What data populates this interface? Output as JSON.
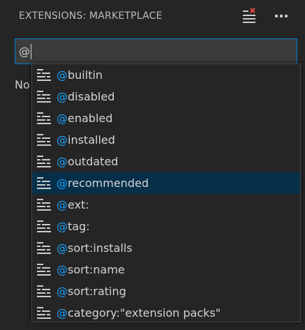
{
  "header": {
    "title": "EXTENSIONS: MARKETPLACE",
    "actions": [
      {
        "name": "clear-list-icon"
      },
      {
        "name": "more-actions-icon"
      }
    ]
  },
  "search": {
    "value": "@"
  },
  "status_text": "No",
  "suggestions": {
    "match_color": "#18a3ff",
    "selected_index": 5,
    "icon": "text-lines-icon",
    "items": [
      {
        "match": "@",
        "rest": "builtin"
      },
      {
        "match": "@",
        "rest": "disabled"
      },
      {
        "match": "@",
        "rest": "enabled"
      },
      {
        "match": "@",
        "rest": "installed"
      },
      {
        "match": "@",
        "rest": "outdated"
      },
      {
        "match": "@",
        "rest": "recommended"
      },
      {
        "match": "@",
        "rest": "ext:"
      },
      {
        "match": "@",
        "rest": "tag:"
      },
      {
        "match": "@",
        "rest": "sort:installs"
      },
      {
        "match": "@",
        "rest": "sort:name"
      },
      {
        "match": "@",
        "rest": "sort:rating"
      },
      {
        "match": "@",
        "rest": "category:\"extension packs\""
      }
    ]
  },
  "colors": {
    "background": "#252526",
    "focus_border": "#007fd4",
    "selection_background": "#062f4a",
    "input_background": "#3c3c3c"
  }
}
